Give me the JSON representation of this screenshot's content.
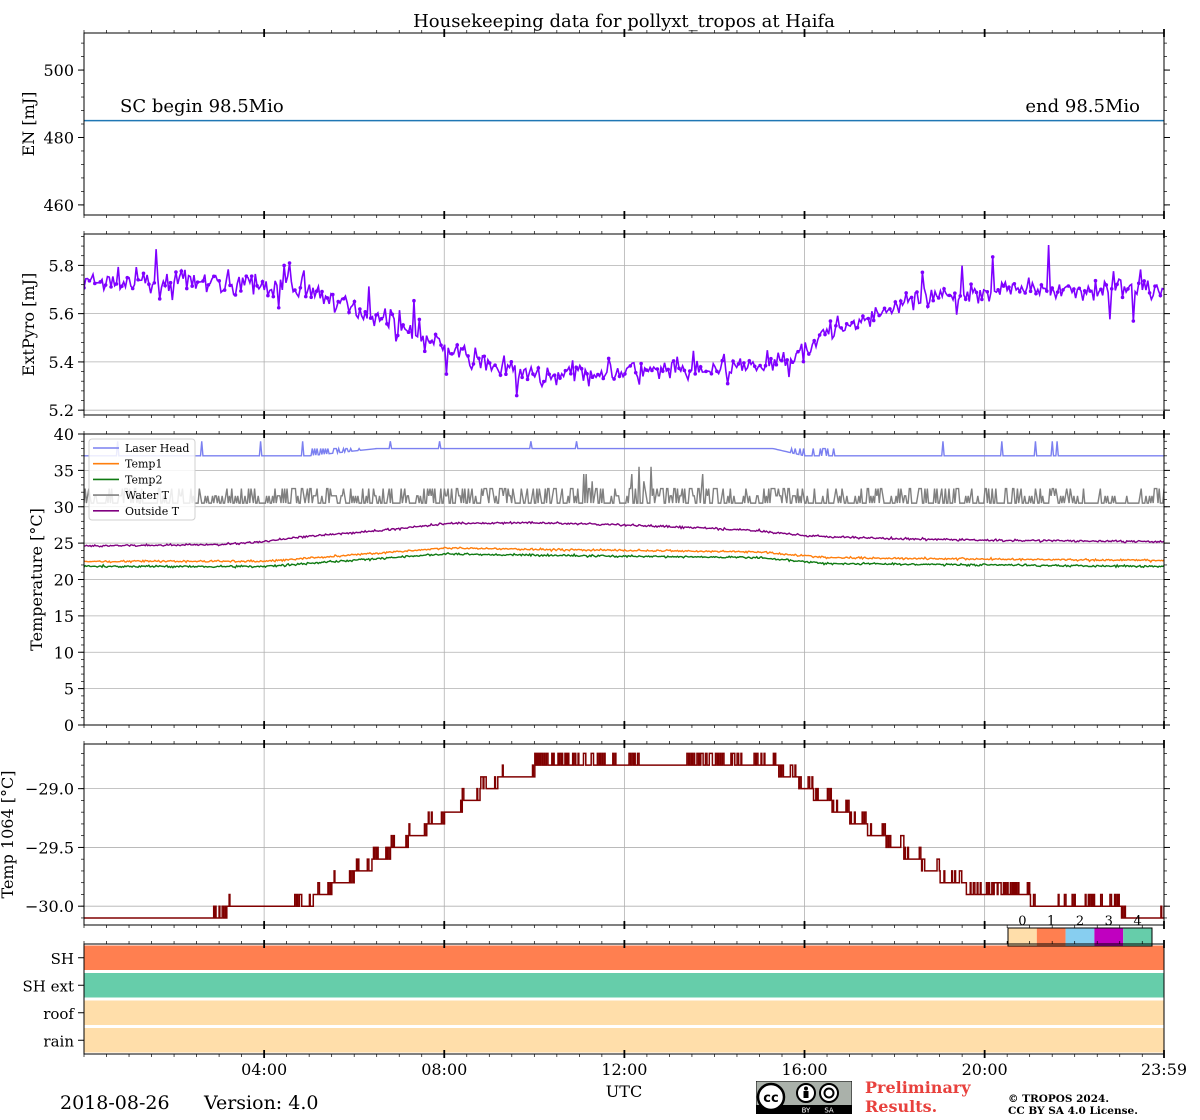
{
  "title": "Housekeeping data for pollyxt_tropos at Haifa",
  "xlabel": "UTC",
  "footer": {
    "date": "2018-08-26",
    "version": "Version: 4.0",
    "prelim_line1": "Preliminary",
    "prelim_line2": "Results.",
    "copyright_line1": "© TROPOS 2024.",
    "copyright_line2": "CC BY SA 4.0 License.",
    "badge_cc": "cc",
    "badge_by": "BY",
    "badge_sa": "SA"
  },
  "colors": {
    "energy": "#1f77b4",
    "pyro": "#7f00ff",
    "laser_head": "#7b80f0",
    "temp1": "#ff7f0e",
    "temp2": "#0f7a12",
    "water": "#808080",
    "outside": "#800080",
    "t1064": "#800000",
    "status": [
      "#ffdeaa",
      "#ff7f50",
      "#87cef0",
      "#c000c0",
      "#66cdaa"
    ]
  },
  "chart_data": [
    {
      "type": "line",
      "id": "energy",
      "ylabel": "EN [mJ]",
      "xlim": [
        0,
        23.983
      ],
      "ylim": [
        457,
        511
      ],
      "yticks": [
        460,
        480,
        500
      ],
      "xticks": [
        4,
        8,
        12,
        16,
        20,
        23.983
      ],
      "grid": false,
      "annotations": [
        "SC begin 98.5Mio",
        "end 98.5Mio"
      ],
      "series": [
        {
          "x": [
            0,
            23.983
          ],
          "y": [
            485,
            485
          ]
        }
      ]
    },
    {
      "type": "line",
      "id": "pyro",
      "ylabel": "ExtPyro [mJ]",
      "xlim": [
        0,
        23.983
      ],
      "ylim": [
        5.18,
        5.93
      ],
      "yticks": [
        5.2,
        5.4,
        5.6,
        5.8
      ],
      "xticks": [
        4,
        8,
        12,
        16,
        20,
        23.983
      ],
      "grid": true,
      "markers": true,
      "trend": {
        "x": [
          0,
          3,
          5,
          7,
          8.5,
          10,
          12,
          14,
          15.5,
          16.5,
          18,
          20,
          23.983
        ],
        "y": [
          5.73,
          5.73,
          5.7,
          5.55,
          5.42,
          5.34,
          5.36,
          5.36,
          5.4,
          5.52,
          5.63,
          5.7,
          5.7
        ]
      },
      "noise": 0.05,
      "n_points": 600
    },
    {
      "type": "line",
      "id": "temperature",
      "ylabel": "Temperature [$^\\circ C$]",
      "xlim": [
        0,
        23.983
      ],
      "ylim": [
        0,
        40
      ],
      "yticks": [
        0,
        5,
        10,
        15,
        20,
        25,
        30,
        35,
        40
      ],
      "xticks": [
        4,
        8,
        12,
        16,
        20,
        23.983
      ],
      "grid": true,
      "legend": "top-left",
      "series": [
        {
          "name": "Laser Head",
          "color_key": "laser_head",
          "base": [
            [
              0,
              37
            ],
            [
              5,
              37
            ],
            [
              6.5,
              38
            ],
            [
              15.3,
              38
            ],
            [
              16,
              37
            ],
            [
              23.983,
              37
            ]
          ],
          "style": "spikes"
        },
        {
          "name": "Temp1",
          "color_key": "temp1",
          "base": [
            [
              0,
              22.5
            ],
            [
              4,
              22.5
            ],
            [
              8,
              24.3
            ],
            [
              12,
              24.0
            ],
            [
              15,
              23.8
            ],
            [
              16.5,
              23.0
            ],
            [
              23.983,
              22.6
            ]
          ],
          "noise": 0.25
        },
        {
          "name": "Temp2",
          "color_key": "temp2",
          "base": [
            [
              0,
              21.8
            ],
            [
              4,
              21.8
            ],
            [
              8,
              23.5
            ],
            [
              12,
              23.2
            ],
            [
              15,
              23.0
            ],
            [
              16.5,
              22.2
            ],
            [
              23.983,
              21.8
            ]
          ],
          "noise": 0.25
        },
        {
          "name": "Water T",
          "color_key": "water",
          "base": [
            [
              0,
              30.5
            ],
            [
              23.983,
              30.5
            ]
          ],
          "style": "toggle"
        },
        {
          "name": "Outside T",
          "color_key": "outside",
          "base": [
            [
              0,
              24.6
            ],
            [
              3,
              24.8
            ],
            [
              4,
              25.2
            ],
            [
              5,
              26.0
            ],
            [
              6,
              26.4
            ],
            [
              7,
              27.0
            ],
            [
              8,
              27.7
            ],
            [
              10,
              27.8
            ],
            [
              12,
              27.5
            ],
            [
              14,
              27.0
            ],
            [
              15,
              26.7
            ],
            [
              16,
              26.0
            ],
            [
              18,
              25.6
            ],
            [
              20,
              25.4
            ],
            [
              23.983,
              25.2
            ]
          ],
          "noise": 0.25
        }
      ]
    },
    {
      "type": "line",
      "id": "t1064",
      "ylabel": "Temp 1064 [$^\\circ C$]",
      "xlim": [
        0,
        23.983
      ],
      "ylim": [
        -30.16,
        -28.62
      ],
      "yticks": [
        -30.0,
        -29.5,
        -29.0
      ],
      "xticks": [
        4,
        8,
        12,
        16,
        20,
        23.983
      ],
      "grid": true,
      "steps": [
        [
          0,
          -30.1
        ],
        [
          3,
          -30.1
        ],
        [
          3.2,
          -30.0
        ],
        [
          4.8,
          -30.0
        ],
        [
          5.1,
          -29.9
        ],
        [
          5.5,
          -29.8
        ],
        [
          6.0,
          -29.7
        ],
        [
          6.4,
          -29.6
        ],
        [
          6.8,
          -29.5
        ],
        [
          7.2,
          -29.4
        ],
        [
          7.6,
          -29.3
        ],
        [
          8.0,
          -29.2
        ],
        [
          8.4,
          -29.1
        ],
        [
          8.8,
          -29.0
        ],
        [
          9.2,
          -28.9
        ],
        [
          10.0,
          -28.8
        ],
        [
          12.2,
          -28.8
        ],
        [
          15.0,
          -28.8
        ],
        [
          15.4,
          -28.9
        ],
        [
          15.8,
          -29.0
        ],
        [
          16.2,
          -29.1
        ],
        [
          16.6,
          -29.2
        ],
        [
          17.0,
          -29.3
        ],
        [
          17.4,
          -29.4
        ],
        [
          17.8,
          -29.5
        ],
        [
          18.2,
          -29.6
        ],
        [
          18.6,
          -29.7
        ],
        [
          19.0,
          -29.8
        ],
        [
          19.5,
          -29.9
        ],
        [
          21.0,
          -30.0
        ],
        [
          23.0,
          -30.1
        ],
        [
          23.983,
          -30.1
        ]
      ]
    },
    {
      "type": "heatmap",
      "id": "status",
      "rows": [
        "SH",
        "SH ext",
        "roof",
        "rain"
      ],
      "row_values": [
        1,
        4,
        0,
        0
      ],
      "colorbar_ticks": [
        "0",
        "1",
        "2",
        "3",
        "4"
      ],
      "xlim": [
        0,
        23.983
      ],
      "xticks": [
        4,
        8,
        12,
        16,
        20,
        23.983
      ],
      "xticklabels": [
        "04:00",
        "08:00",
        "12:00",
        "16:00",
        "20:00",
        "23:59"
      ]
    }
  ]
}
